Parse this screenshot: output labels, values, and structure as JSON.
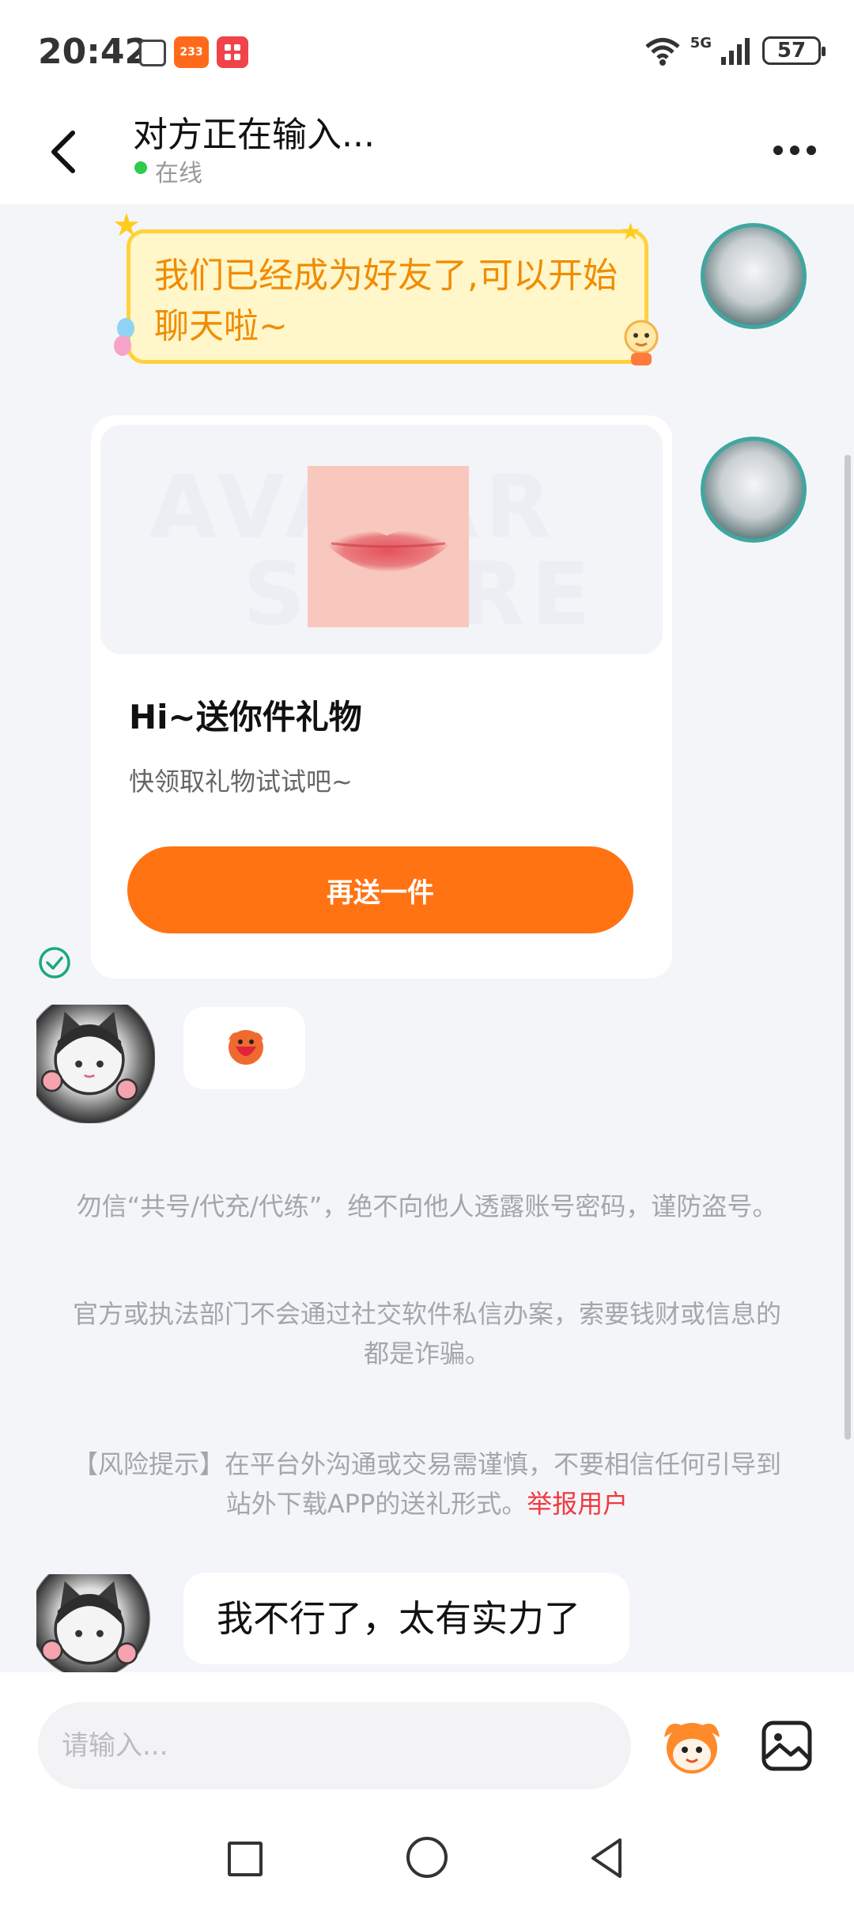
{
  "status_bar": {
    "time": "20:42",
    "app_icon_2": "233",
    "network": "5G",
    "battery": "57"
  },
  "header": {
    "title": "对方正在输入...",
    "status": "在线"
  },
  "messages": {
    "system_greeting": "我们已经成为好友了,可以开始聊天啦~",
    "gift": {
      "title": "Hi~送你件礼物",
      "subtitle": "快领取礼物试试吧~",
      "button": "再送一件",
      "watermark_1": "AVATAR",
      "watermark_2": "STORE"
    },
    "last_text": "我不行了，太有实力了"
  },
  "notices": {
    "account_warning": "勿信“共号/代充/代练”，绝不向他人透露账号密码，谨防盗号。",
    "fraud_warning": "官方或执法部门不会通过社交软件私信办案，索要钱财或信息的都是诈骗。",
    "risk_warning": "【风险提示】在平台外沟通或交易需谨慎，不要相信任何引导到站外下载APP的送礼形式。",
    "report_link": "举报用户"
  },
  "input": {
    "placeholder": "请输入..."
  },
  "icons": {
    "back": "chevron-left-icon",
    "more": "more-dots-icon",
    "emoji": "emoji-icon",
    "image": "image-icon",
    "sent": "check-circle-icon"
  },
  "colors": {
    "accent_orange": "#ff7313",
    "online_green": "#2ecb4f",
    "system_bubble_bg": "#fff6c9",
    "system_text": "#f08c00",
    "report_red": "#f0393f"
  }
}
